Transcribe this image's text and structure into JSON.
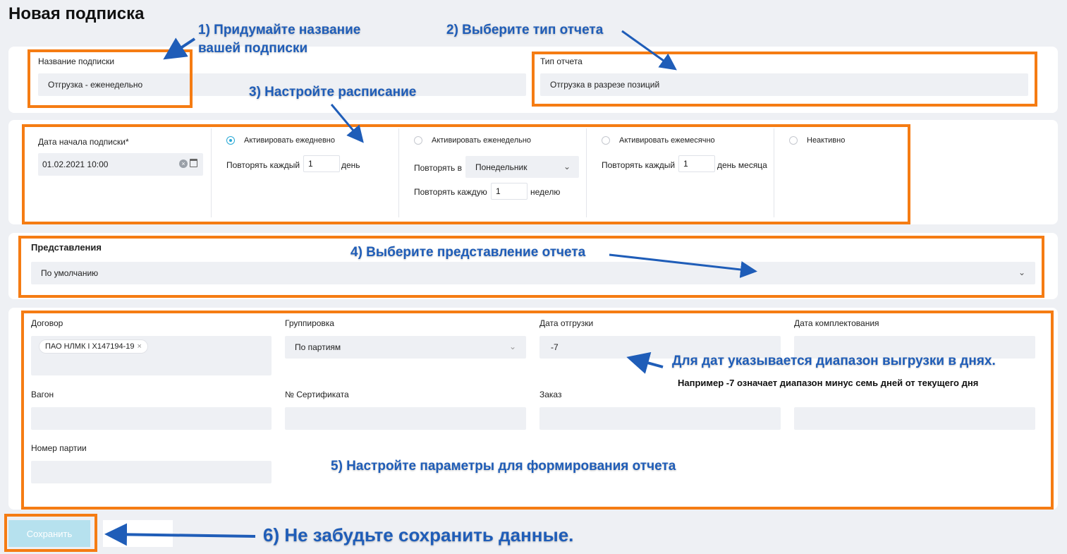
{
  "page": {
    "title": "Новая подписка"
  },
  "subscription": {
    "name_label": "Название подписки",
    "name_value": "Отгрузка - еженедельно",
    "report_type_label": "Тип отчета",
    "report_type_value": "Отгрузка в разрезе позиций"
  },
  "schedule": {
    "start_label": "Дата начала подписки*",
    "start_value": "01.02.2021 10:00",
    "daily": {
      "label": "Активировать ежедневно",
      "repeat_label": "Повторять каждый",
      "repeat_value": "1",
      "unit": "день",
      "selected": true
    },
    "weekly": {
      "label": "Активировать еженедельно",
      "repeat_in_label": "Повторять в",
      "day_value": "Понедельник",
      "repeat_label": "Повторять каждую",
      "repeat_value": "1",
      "unit": "неделю"
    },
    "monthly": {
      "label": "Активировать ежемесячно",
      "repeat_label": "Повторять каждый",
      "repeat_value": "1",
      "unit": "день месяца"
    },
    "inactive": {
      "label": "Неактивно"
    }
  },
  "views": {
    "label": "Представления",
    "value": "По умолчанию"
  },
  "params": {
    "contract_label": "Договор",
    "contract_chip": "ПАО НЛМК I Х147194-19",
    "grouping_label": "Группировка",
    "grouping_value": "По партиям",
    "ship_date_label": "Дата отгрузки",
    "ship_date_value": "-7",
    "pick_date_label": "Дата комплектования",
    "wagon_label": "Вагон",
    "cert_label": "№ Сертификата",
    "order_label": "Заказ",
    "batch_label": "Номер партии"
  },
  "actions": {
    "save_label": "Сохранить"
  },
  "annotations": {
    "a1_line1": "1) Придумайте название",
    "a1_line2": "вашей подписки",
    "a2": "2) Выберите тип отчета",
    "a3": "3) Настройте расписание",
    "a4": "4) Выберите представление отчета",
    "a5": "5) Настройте параметры для формирования отчета",
    "a6": "6) Не забудьте сохранить данные.",
    "dates_note": "Для дат указывается диапазон выгрузки в днях.",
    "dates_example": "Например -7 означает диапазон минус семь дней от текущего дня"
  },
  "colors": {
    "highlight": "#f57c13",
    "annotation": "#1f5db8",
    "accent": "#29a9d6",
    "save_button": "#b6e1ee"
  }
}
